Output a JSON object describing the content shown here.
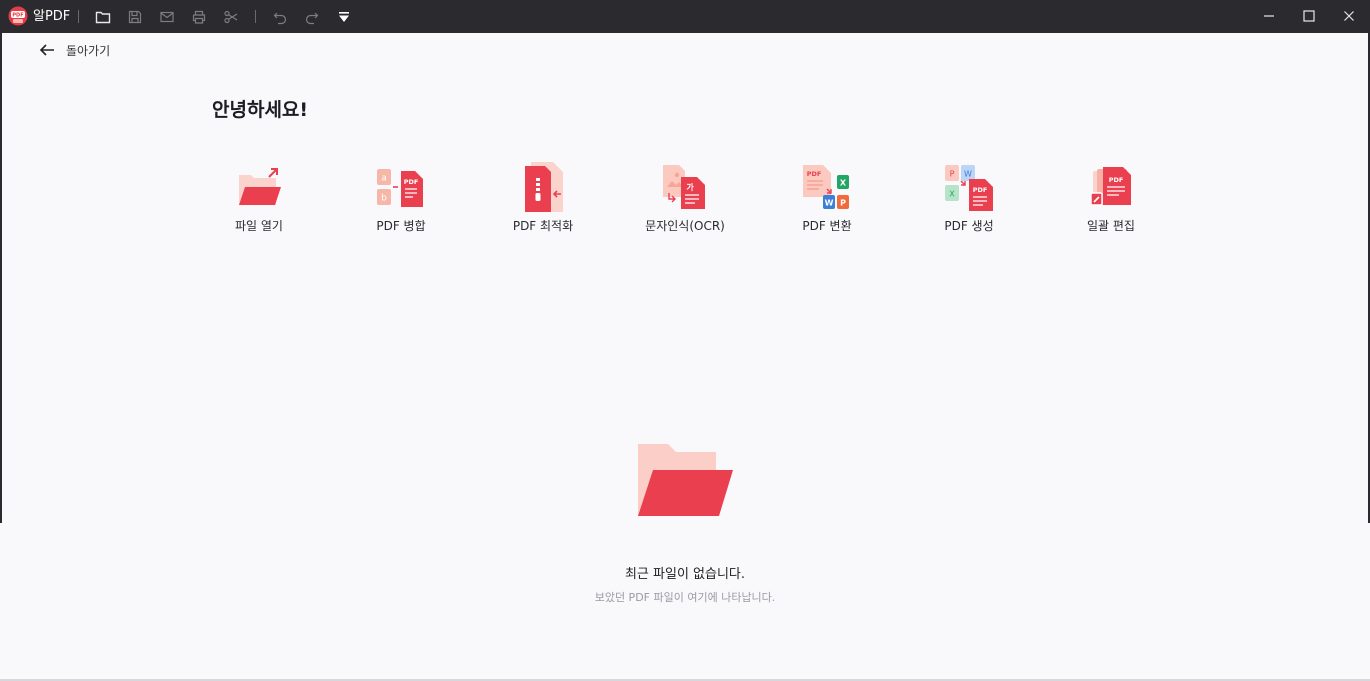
{
  "app": {
    "title": "알PDF"
  },
  "titlebar": {
    "tools": [
      "folder-open-icon",
      "save-icon",
      "mail-icon",
      "print-icon",
      "scissors-icon",
      "undo-icon",
      "redo-icon",
      "dropdown-arrow-icon"
    ]
  },
  "nav": {
    "back_label": "돌아가기"
  },
  "home": {
    "greeting": "안녕하세요!",
    "tools": [
      {
        "label": "파일 열기",
        "icon": "open-folder-icon"
      },
      {
        "label": "PDF 병합",
        "icon": "merge-icon"
      },
      {
        "label": "PDF 최적화",
        "icon": "zip-icon"
      },
      {
        "label": "문자인식(OCR)",
        "icon": "ocr-icon"
      },
      {
        "label": "PDF 변환",
        "icon": "convert-icon"
      },
      {
        "label": "PDF 생성",
        "icon": "create-icon"
      },
      {
        "label": "일괄 편집",
        "icon": "batch-edit-icon"
      }
    ]
  },
  "recent": {
    "empty_title": "최근 파일이 없습니다.",
    "empty_subtitle": "보았던 PDF 파일이 여기에 나타납니다."
  },
  "colors": {
    "accent": "#ea3f4f",
    "accent_light": "#f9c8c4",
    "titlebar": "#2b2b2f"
  }
}
